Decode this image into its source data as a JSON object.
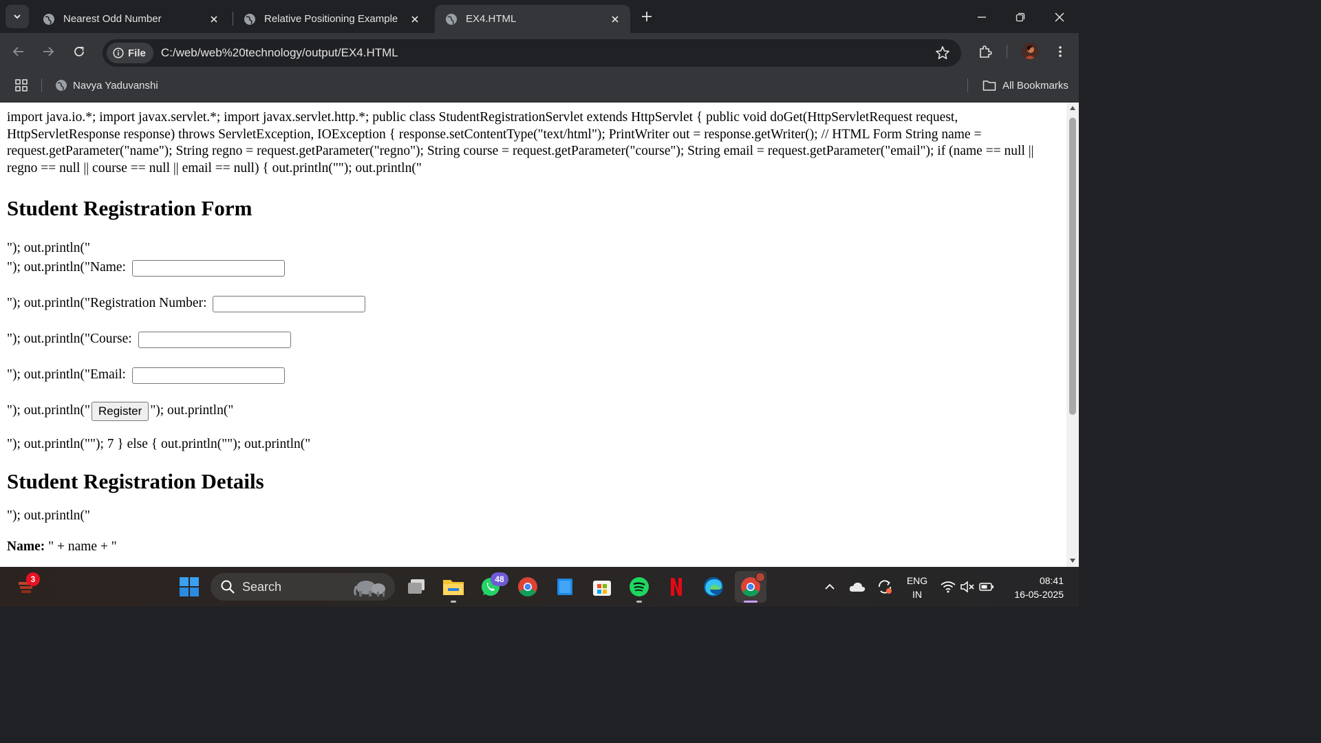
{
  "browser": {
    "tabs": [
      {
        "title": "Nearest Odd Number",
        "active": false
      },
      {
        "title": "Relative Positioning Example",
        "active": false
      },
      {
        "title": "EX4.HTML",
        "active": true
      }
    ],
    "site_chip": "File",
    "url": "C:/web/web%20technology/output/EX4.HTML",
    "bookmarks": {
      "profile_bookmark": "Navya Yaduvanshi",
      "all_bookmarks": "All Bookmarks"
    }
  },
  "page": {
    "code_paragraph": "import java.io.*; import javax.servlet.*; import javax.servlet.http.*; public class StudentRegistrationServlet extends HttpServlet { public void doGet(HttpServletRequest request, HttpServletResponse response) throws ServletException, IOException { response.setContentType(\"text/html\"); PrintWriter out = response.getWriter(); // HTML Form String name = request.getParameter(\"name\"); String regno = request.getParameter(\"regno\"); String course = request.getParameter(\"course\"); String email = request.getParameter(\"email\"); if (name == null || regno == null || course == null || email == null) { out.println(\"\"); out.println(\"",
    "heading_form": "Student Registration Form",
    "line_after_heading": "\"); out.println(\"",
    "name_label": "\"); out.println(\"Name:",
    "regno_label": "\"); out.println(\"Registration Number:",
    "course_label": "\"); out.println(\"Course:",
    "email_label": "\"); out.println(\"Email:",
    "register_prefix": "\"); out.println(\"",
    "register_button": "Register",
    "register_suffix": "\"); out.println(\"",
    "else_line": "\"); out.println(\"\"); 7 } else { out.println(\"\"); out.println(\"",
    "heading_details": "Student Registration Details",
    "details_line": "\"); out.println(\"",
    "name_detail_label": "Name:",
    "name_detail_value": " \" + name + \""
  },
  "taskbar": {
    "widgets_badge": "3",
    "search_placeholder": "Search",
    "whatsapp_badge": "48",
    "language_top": "ENG",
    "language_bottom": "IN",
    "time": "08:41",
    "date": "16-05-2025"
  }
}
